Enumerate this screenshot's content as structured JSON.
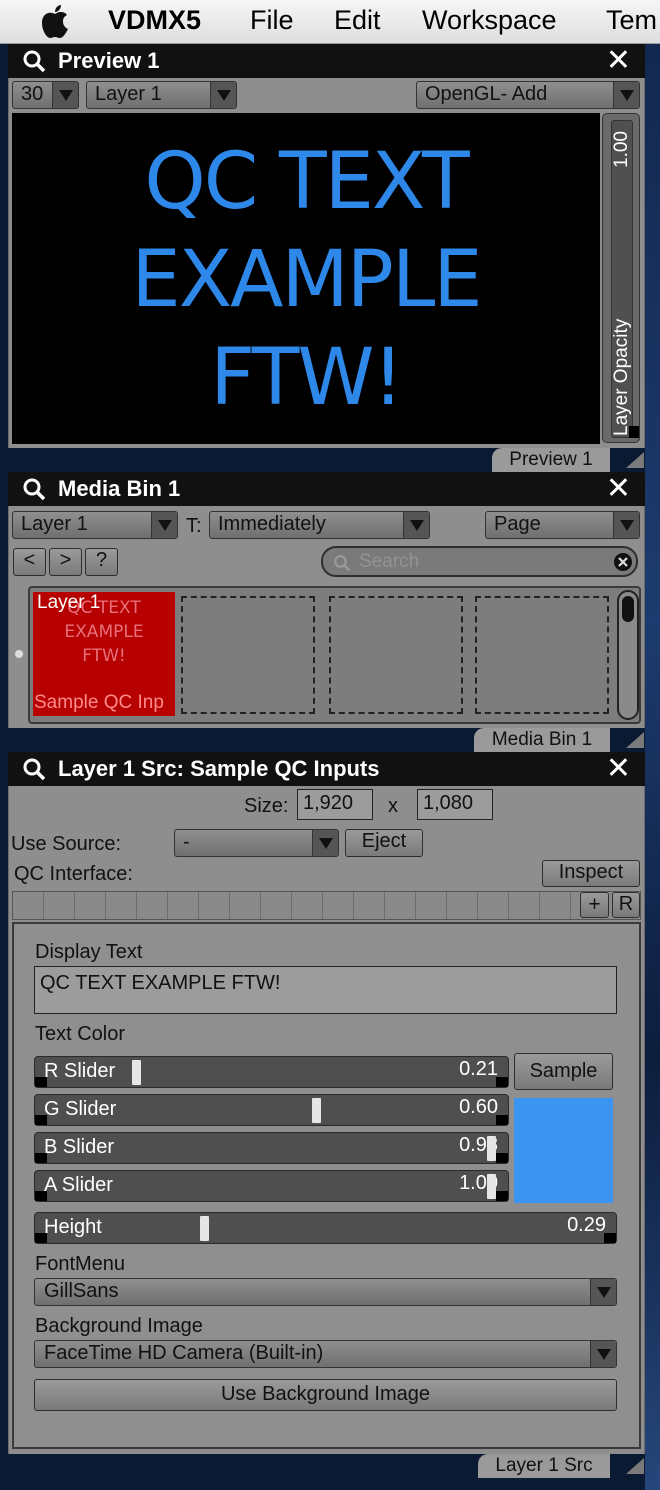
{
  "menubar": {
    "apple_icon": "apple-logo",
    "items": [
      "VDMX5",
      "File",
      "Edit",
      "Workspace",
      "Tem"
    ]
  },
  "preview": {
    "title": "Preview 1",
    "fps": "30",
    "layer": "Layer 1",
    "blend_mode": "OpenGL- Add",
    "canvas_lines": [
      "QC TEXT",
      "EXAMPLE",
      "FTW!"
    ],
    "text_color": "#2d88ea",
    "opacity_value": "1.00",
    "opacity_label": "Layer Opacity",
    "opacity_level": 1.0,
    "tab_label": "Preview 1"
  },
  "media_bin": {
    "title": "Media Bin 1",
    "layer": "Layer 1",
    "trigger_label": "T:",
    "trigger_mode": "Immediately",
    "page": "Page",
    "nav": [
      "<",
      ">",
      "?"
    ],
    "search_placeholder": "Search",
    "clip": {
      "layer_label": "Layer 1",
      "ghost_lines": [
        "QC TEXT",
        "EXAMPLE",
        "FTW!"
      ],
      "name": "Sample QC Inp"
    },
    "tab_label": "Media Bin 1"
  },
  "layer_src": {
    "title": "Layer 1 Src: Sample QC Inputs",
    "size_label": "Size:",
    "width": "1,920",
    "x_label": "x",
    "height_px": "1,080",
    "use_source_label": "Use Source:",
    "use_source_value": "-",
    "eject_label": "Eject",
    "qc_interface_label": "QC Interface:",
    "inspect_label": "Inspect",
    "plus_label": "+",
    "r_label": "R",
    "display_text_label": "Display Text",
    "display_text_value": "QC TEXT EXAMPLE FTW!",
    "text_color_label": "Text Color",
    "sliders": [
      {
        "label": "R Slider",
        "value": "0.21",
        "level": 0.21
      },
      {
        "label": "G Slider",
        "value": "0.60",
        "level": 0.6
      },
      {
        "label": "B Slider",
        "value": "0.98",
        "level": 0.98
      },
      {
        "label": "A Slider",
        "value": "1.00",
        "level": 1.0
      }
    ],
    "sample_label": "Sample",
    "swatch_color": "#3b93f2",
    "height_slider": {
      "label": "Height",
      "value": "0.29",
      "level": 0.29
    },
    "font_menu_label": "FontMenu",
    "font_menu_value": "GillSans",
    "background_image_label": "Background Image",
    "background_image_value": "FaceTime HD Camera (Built-in)",
    "use_background_label": "Use Background Image",
    "tab_label": "Layer 1 Src"
  }
}
